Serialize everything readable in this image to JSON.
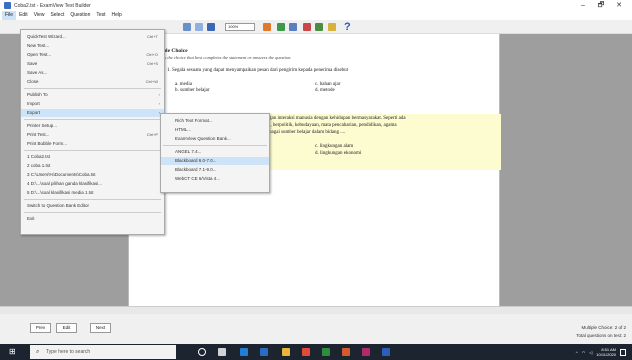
{
  "window": {
    "title": "Coba2.tst - ExamView Test Builder",
    "controls": [
      "–",
      "🗗",
      "✕"
    ]
  },
  "menubar": [
    "File",
    "Edit",
    "View",
    "Select",
    "Question",
    "Test",
    "Help"
  ],
  "toolbar": {
    "zoom": "100%"
  },
  "file_menu": [
    {
      "label": "QuickTest Wizard...",
      "shortcut": "Ctrl+T"
    },
    {
      "label": "New Test...",
      "shortcut": ""
    },
    {
      "label": "Open Test...",
      "shortcut": "Ctrl+O"
    },
    {
      "label": "Save",
      "shortcut": "Ctrl+S"
    },
    {
      "label": "Save As...",
      "shortcut": ""
    },
    {
      "label": "Close",
      "shortcut": "Ctrl+W"
    },
    {
      "label": "Publish To",
      "shortcut": "",
      "sub": true
    },
    {
      "label": "Import",
      "shortcut": "",
      "sub": true
    },
    {
      "label": "Export",
      "shortcut": "",
      "sub": true,
      "highlight": true
    },
    {
      "label": "Printer Setup...",
      "shortcut": ""
    },
    {
      "label": "Print Test...",
      "shortcut": "Ctrl+P"
    },
    {
      "label": "Print Bubble Form...",
      "shortcut": ""
    },
    {
      "label": "1 Coba2.tst",
      "shortcut": ""
    },
    {
      "label": "2 coba 1.tst",
      "shortcut": ""
    },
    {
      "label": "3 C:\\Users\\%\\Documents\\Coba.tst",
      "shortcut": ""
    },
    {
      "label": "4 D:\\...\\soal pilihan ganda klasifikasi...",
      "shortcut": ""
    },
    {
      "label": "5 D:\\...\\soal klasifikasi media 1.tst",
      "shortcut": ""
    },
    {
      "label": "Switch to Question Bank Editor",
      "shortcut": ""
    },
    {
      "label": "Exit",
      "shortcut": ""
    }
  ],
  "export_submenu": [
    {
      "label": "Rich Text Format...",
      "highlight": false
    },
    {
      "label": "HTML...",
      "highlight": false
    },
    {
      "label": "ExamView Question Bank...",
      "highlight": false
    },
    {
      "label": "ANGEL 7.4...",
      "highlight": false
    },
    {
      "label": "Blackboard 6.0-7.0...",
      "highlight": true
    },
    {
      "label": "Blackboard 7.1-9.0...",
      "highlight": false
    },
    {
      "label": "WebCT CE 6/Vista 4...",
      "highlight": false
    }
  ],
  "document": {
    "section_title": "ple Choice",
    "instruction": "fy the choice that best completes the statement or answers the question.",
    "q1": {
      "text": "1.  Segala sesuatu yang dapat menyampaikan pesan dari pengirim kepada penerima disebut",
      "a": "a.   media",
      "b": "b.   sumber belajar",
      "c": "c.   bahan ajar",
      "d": "d.   metode"
    },
    "q2": {
      "line1": "gan interaksi manusia dengan kehidupan bermasyarakat. Seperti ada",
      "line2": "i, berpolitik, kebudayaan, mata pencaharian, pendidikan, agama",
      "line3": "bagai sumber belajar dalam bidang ....",
      "c": "c.   lingkungan alam",
      "d": "d.   lingkungan ekonomi"
    }
  },
  "navigation": {
    "prev": "Prev",
    "edit": "Edit",
    "next": "Next"
  },
  "status": {
    "line1": "Multiple Choice: 2 of 2",
    "line2": "Total questions on test: 2"
  },
  "taskbar": {
    "search_placeholder": "Type here to search",
    "time": "8:51 AM",
    "date": "10/11/2020"
  }
}
